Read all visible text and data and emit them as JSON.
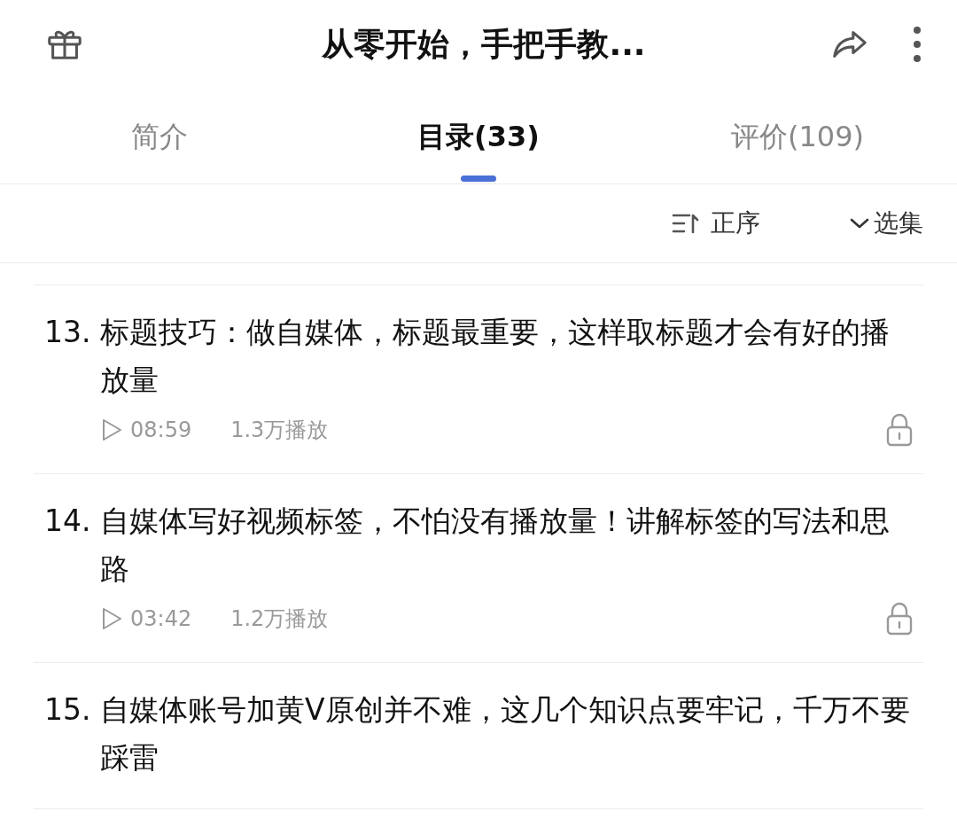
{
  "header": {
    "title": "从零开始，手把手教..."
  },
  "tabs": [
    {
      "label": "简介",
      "selected": false
    },
    {
      "label": "目录(33)",
      "selected": true
    },
    {
      "label": "评价(109)",
      "selected": false
    }
  ],
  "toolbar": {
    "sort": "正序",
    "select": "选集"
  },
  "episodes": [
    {
      "number": "13.",
      "title": "标题技巧：做自媒体，标题最重要，这样取标题才会有好的播放量",
      "duration": "08:59",
      "plays": "1.3万播放",
      "locked": true
    },
    {
      "number": "14.",
      "title": "自媒体写好视频标签，不怕没有播放量！讲解标签的写法和思路",
      "duration": "03:42",
      "plays": "1.2万播放",
      "locked": true
    },
    {
      "number": "15.",
      "title": "自媒体账号加黄V原创并不难，这几个知识点要牢记，千万不要踩雷"
    }
  ]
}
